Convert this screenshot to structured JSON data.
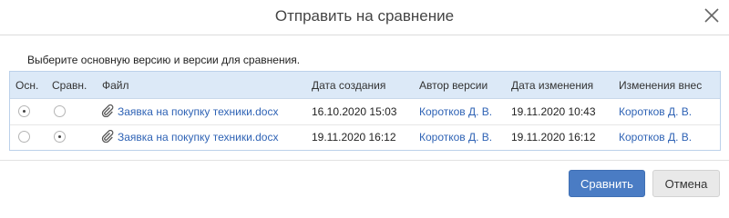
{
  "dialog": {
    "title": "Отправить на сравнение",
    "instruction": "Выберите основную версию и версии для сравнения."
  },
  "table": {
    "columns": {
      "main": "Осн.",
      "compare": "Сравн.",
      "file": "Файл",
      "created": "Дата создания",
      "author": "Автор версии",
      "modified": "Дата изменения",
      "modified_by": "Изменения внес"
    },
    "rows": [
      {
        "main_selected": true,
        "compare_selected": false,
        "file": "Заявка на покупку техники.docx",
        "created": "16.10.2020 15:03",
        "author": "Коротков Д. В.",
        "modified": "19.11.2020 10:43",
        "modified_by": "Коротков Д. В."
      },
      {
        "main_selected": false,
        "compare_selected": true,
        "file": "Заявка на покупку техники.docx",
        "created": "19.11.2020 16:12",
        "author": "Коротков Д. В.",
        "modified": "19.11.2020 16:12",
        "modified_by": "Коротков Д. В."
      }
    ]
  },
  "buttons": {
    "compare": "Сравнить",
    "cancel": "Отмена"
  },
  "colors": {
    "primary": "#4a7cc4",
    "link": "#2f63b5",
    "header_bg": "#dce9f7"
  },
  "icons": {
    "close": "close-icon",
    "attachment": "paperclip-icon"
  }
}
